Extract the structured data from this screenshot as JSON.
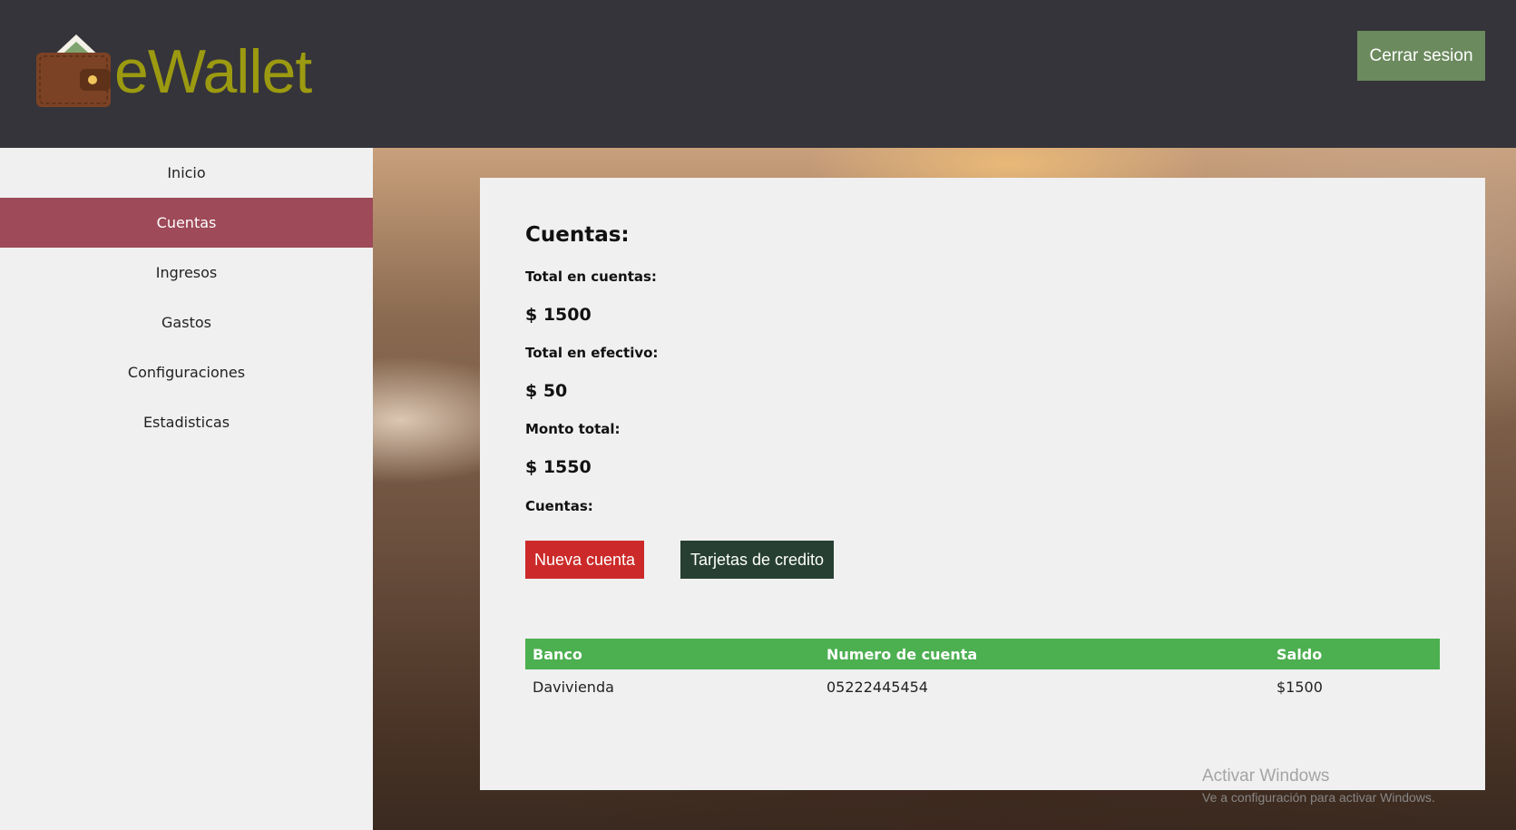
{
  "header": {
    "brand": "eWallet",
    "logout_label": "Cerrar sesion"
  },
  "sidebar": {
    "items": [
      {
        "label": "Inicio"
      },
      {
        "label": "Cuentas"
      },
      {
        "label": "Ingresos"
      },
      {
        "label": "Gastos"
      },
      {
        "label": "Configuraciones"
      },
      {
        "label": "Estadisticas"
      }
    ]
  },
  "main": {
    "title": "Cuentas:",
    "total_accounts_label": "Total en cuentas:",
    "total_accounts_value": "$ 1500",
    "total_cash_label": "Total en efectivo:",
    "total_cash_value": "$ 50",
    "total_label": "Monto total:",
    "total_value": "$ 1550",
    "accounts_label": "Cuentas:",
    "new_account_button": "Nueva cuenta",
    "credit_cards_button": "Tarjetas de credito",
    "table": {
      "headers": [
        "Banco",
        "Numero de cuenta",
        "Saldo"
      ],
      "rows": [
        [
          "Davivienda",
          "05222445454",
          "$1500"
        ]
      ]
    }
  },
  "watermark": {
    "title": "Activar Windows",
    "subtitle": "Ve a configuración para activar Windows."
  }
}
